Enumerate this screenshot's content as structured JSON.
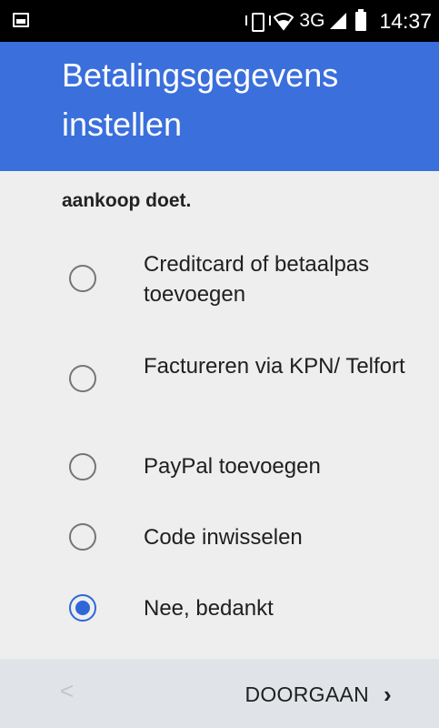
{
  "status_bar": {
    "network": "3G",
    "time": "14:37"
  },
  "header": {
    "title": "Betalingsgegevens instellen"
  },
  "content": {
    "intro_visible": "aankoop doet.",
    "options": [
      {
        "label": "Creditcard of betaalpas toevoegen",
        "selected": false
      },
      {
        "label": "Factureren via KPN/ Telfort",
        "selected": false
      },
      {
        "label": "PayPal toevoegen",
        "selected": false
      },
      {
        "label": "Code inwisselen",
        "selected": false
      },
      {
        "label": "Nee, bedankt",
        "selected": true
      }
    ]
  },
  "bottom_nav": {
    "back_icon": "chevron-left-icon",
    "back_glyph": "<",
    "next_label": "DOORGAAN",
    "next_glyph": "›"
  },
  "colors": {
    "header_bg": "#3a6fdc",
    "radio_selected": "#2f66d8"
  }
}
